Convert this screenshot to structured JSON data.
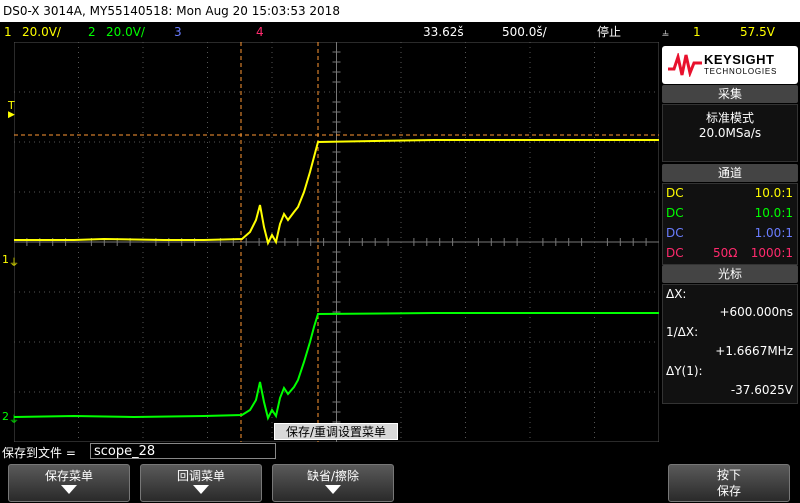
{
  "title": "DS0-X 3014A, MY55140518: Mon Aug 20 15:03:53 2018",
  "status": {
    "ch1_num": "1",
    "ch1_scale": "20.0V/",
    "ch2_num": "2",
    "ch2_scale": "20.0V/",
    "ch3_num": "3",
    "ch4_num": "4",
    "time_offset": "33.62š",
    "timebase": "500.0š/",
    "run_state": "停止",
    "trig_icon": "⫨",
    "trig_src": "1",
    "trig_level": "57.5V"
  },
  "markers": {
    "trigger": "T",
    "ch1": "1",
    "ch2": "2"
  },
  "logo": {
    "brand": "KEYSIGHT",
    "sub": "TECHNOLOGIES"
  },
  "acquire": {
    "header": "采集",
    "mode": "标准模式",
    "rate": "20.0MSa/s"
  },
  "channels": {
    "header": "通道",
    "rows": [
      {
        "coupling": "DC",
        "impedance": "",
        "probe": "10.0:1",
        "color": "#ffff00"
      },
      {
        "coupling": "DC",
        "impedance": "",
        "probe": "10.0:1",
        "color": "#00ff00"
      },
      {
        "coupling": "DC",
        "impedance": "",
        "probe": "1.00:1",
        "color": "#6a7dff"
      },
      {
        "coupling": "DC",
        "impedance": "50Ω",
        "probe": "1000:1",
        "color": "#ff2a6d"
      }
    ]
  },
  "cursors": {
    "header": "光标",
    "dx_label": "ΔX:",
    "dx_value": "+600.000ns",
    "inv_label": "1/ΔX:",
    "inv_value": "+1.6667MHz",
    "dy_label": "ΔY(1):",
    "dy_value": "-37.6025V"
  },
  "save": {
    "label": "保存到文件 =",
    "filename": "scope_28"
  },
  "popup": "保存/重调设置菜单",
  "softkeys": [
    {
      "label": "保存菜单"
    },
    {
      "label": "回调菜单"
    },
    {
      "label": "缺省/擦除"
    },
    {
      "label": "按下\n保存"
    }
  ],
  "colors": {
    "ch1": "#ffff00",
    "ch2": "#00ff00",
    "ch3": "#6a7dff",
    "ch4": "#ff2a6d",
    "cursor": "#ff9933"
  }
}
